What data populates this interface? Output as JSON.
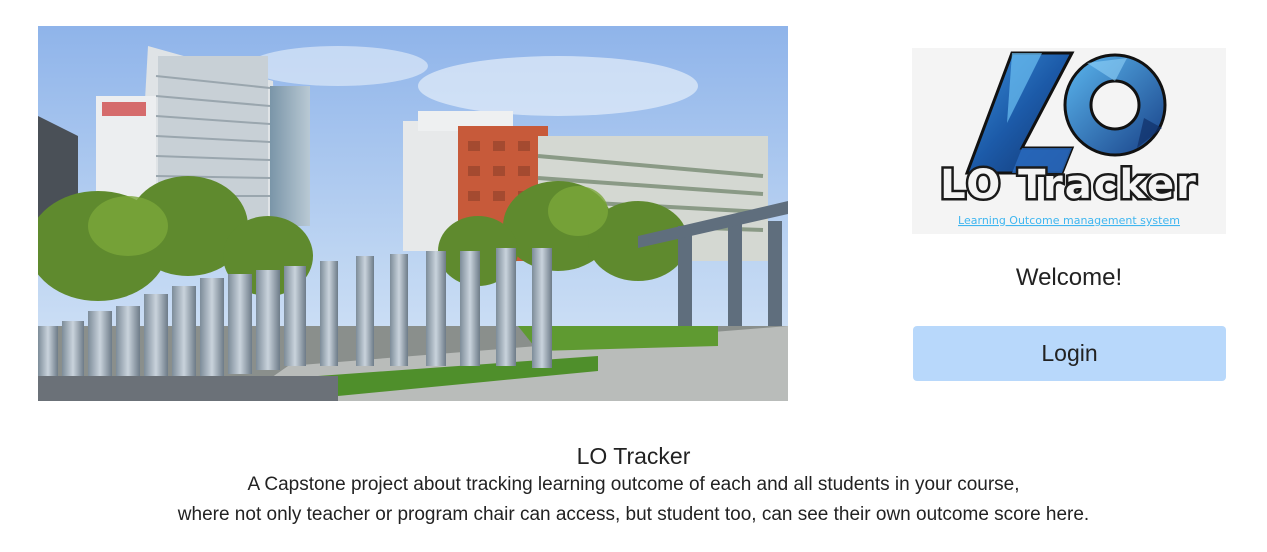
{
  "hero": {
    "image_alt": "Campus buildings with trees and modern sculpture"
  },
  "logo": {
    "title": "LO Tracker",
    "subtitle": "Learning Outcome management system",
    "monogram": "LO"
  },
  "auth": {
    "welcome_text": "Welcome!",
    "login_label": "Login",
    "login_button_color": "#b8d8fb"
  },
  "about": {
    "title": "LO Tracker",
    "line1": "A Capstone project about tracking learning outcome of each and all students in your course,",
    "line2": "where not only teacher or program chair can access, but student too, can see their own outcome score here."
  }
}
